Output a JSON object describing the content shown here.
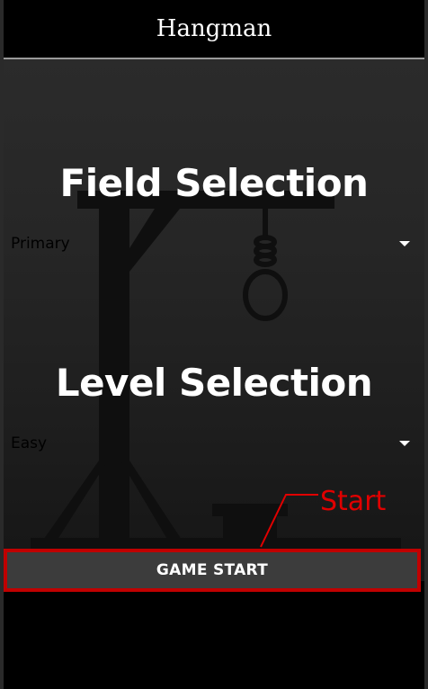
{
  "app": {
    "title": "Hangman"
  },
  "field_section": {
    "heading": "Field Selection",
    "selected": "Primary"
  },
  "level_section": {
    "heading": "Level Selection",
    "selected": "Easy"
  },
  "annotation": {
    "label": "Start",
    "color": "#e00000"
  },
  "button": {
    "label": "GAME START"
  },
  "icons": [
    "gallows-illustration",
    "dropdown-arrow-icon"
  ]
}
